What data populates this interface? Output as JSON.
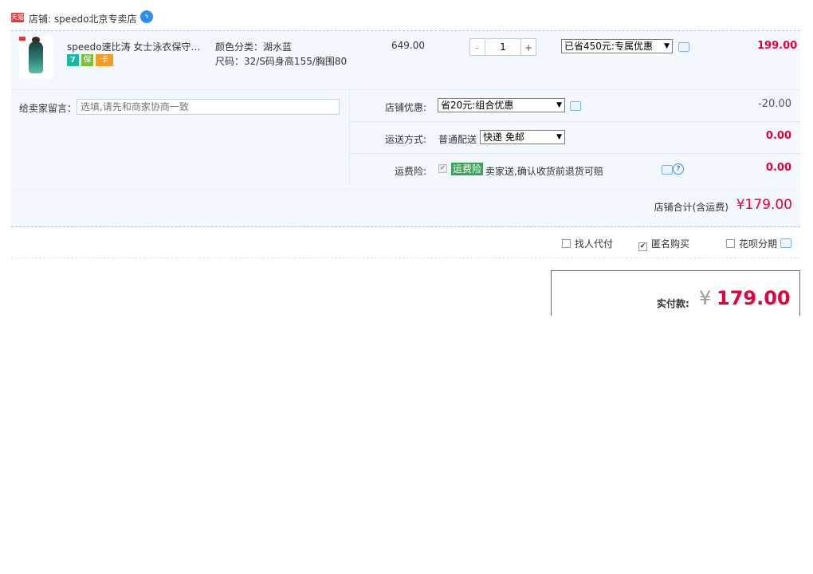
{
  "shop": {
    "badge": "天猫",
    "label": "店铺: speedo北京专卖店",
    "ww_icon": "wangwang-icon"
  },
  "item": {
    "title": "speedo速比涛 女士泳衣保守连...",
    "badges": [
      "7",
      "保",
      "卡"
    ],
    "sku_color": "颜色分类：湖水蓝",
    "sku_size": "尺码：32/S码身高155/胸围80",
    "unit_price": "649.00",
    "quantity": "1",
    "qty_minus": "-",
    "qty_plus": "+",
    "discount_option": "已省450元:专属优惠",
    "total": "199.00"
  },
  "memo": {
    "label": "给卖家留言：",
    "placeholder": "选填,请先和商家协商一致"
  },
  "options": {
    "coupon_label": "店铺优惠:",
    "coupon_option": "省20元:组合优惠",
    "coupon_value": "-20.00",
    "shipping_label": "运送方式:",
    "shipping_text": "普通配送",
    "shipping_option": "快递 免邮",
    "shipping_value": "0.00",
    "insurance_label": "运费险:",
    "insurance_tag": "运费险",
    "insurance_desc": "卖家送,确认收货前退货可赔",
    "insurance_value": "0.00"
  },
  "shop_total": {
    "label": "店铺合计(含运费)",
    "value": "¥179.00"
  },
  "pay_options": {
    "proxy": "找人代付",
    "anonymous": "匿名购买",
    "huabei": "花呗分期"
  },
  "final": {
    "label": "实付款:",
    "currency": "¥",
    "value": "179.00"
  },
  "colors": {
    "accent_red": "#e4003a",
    "panel_bg": "#f3f8fe",
    "insurance_green": "#3ca55c"
  }
}
